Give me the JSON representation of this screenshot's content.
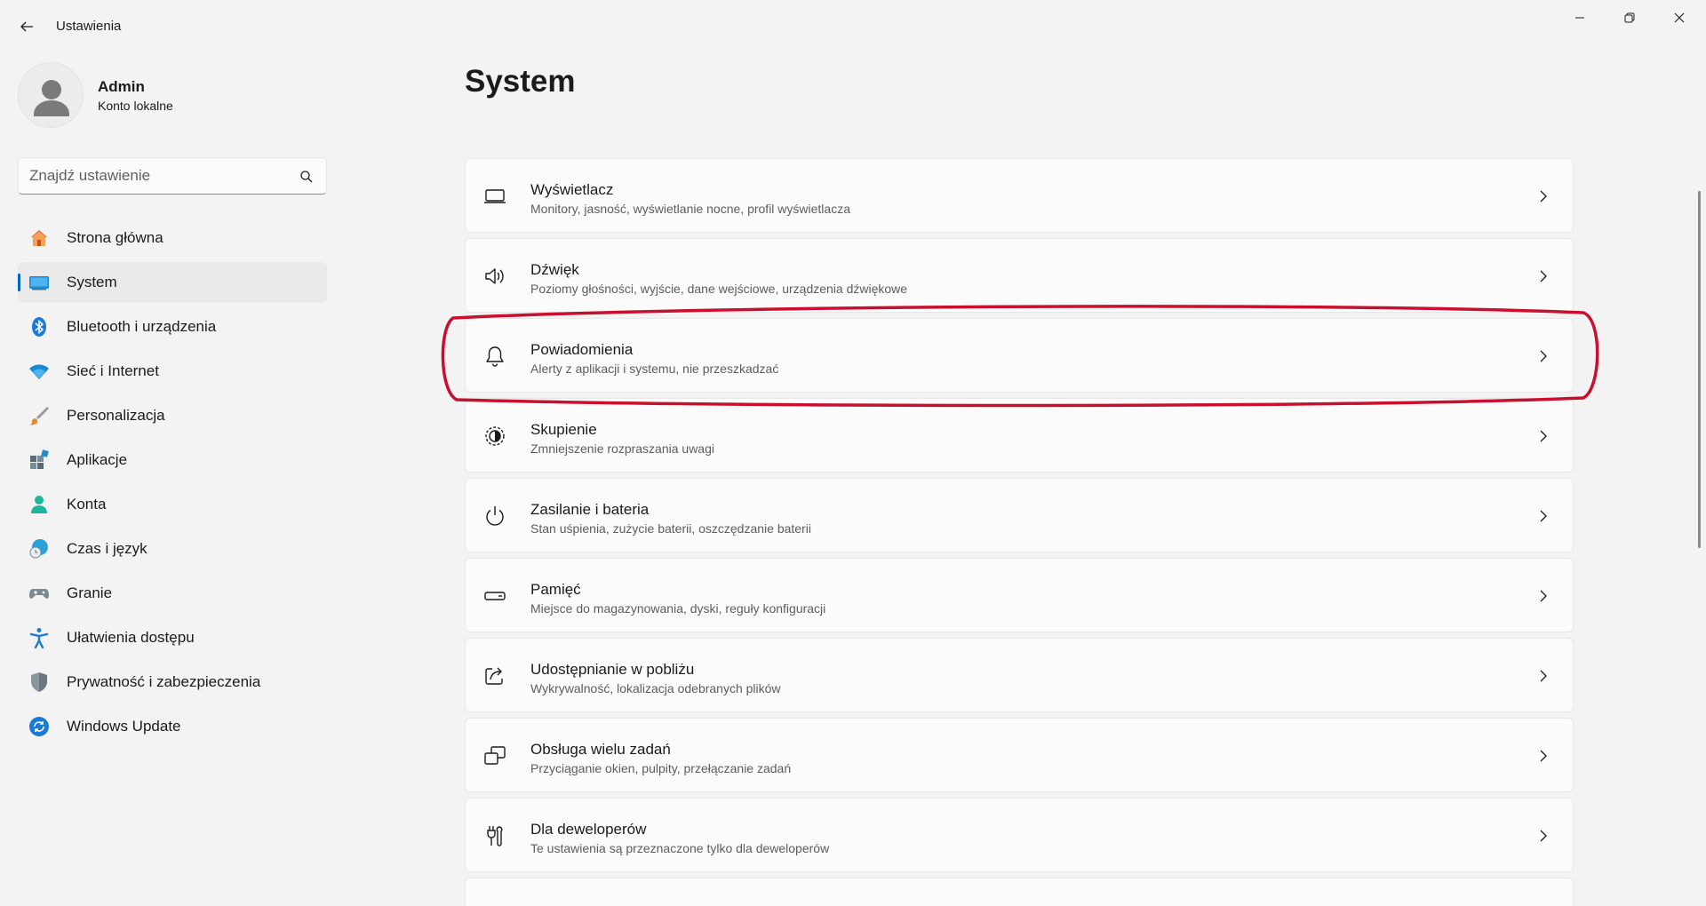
{
  "window": {
    "title": "Ustawienia",
    "controls": [
      "minimize-icon",
      "maximize-icon",
      "close-icon"
    ]
  },
  "profile": {
    "name": "Admin",
    "account": "Konto lokalne"
  },
  "search": {
    "placeholder": "Znajdź ustawienie",
    "value": ""
  },
  "sidebar": {
    "items": [
      {
        "label": "Strona główna",
        "icon": "home-icon"
      },
      {
        "label": "System",
        "icon": "system-icon",
        "active": true
      },
      {
        "label": "Bluetooth i urządzenia",
        "icon": "bluetooth-icon"
      },
      {
        "label": "Sieć i Internet",
        "icon": "wifi-icon"
      },
      {
        "label": "Personalizacja",
        "icon": "brush-icon"
      },
      {
        "label": "Aplikacje",
        "icon": "apps-icon"
      },
      {
        "label": "Konta",
        "icon": "account-icon"
      },
      {
        "label": "Czas i język",
        "icon": "globe-clock-icon"
      },
      {
        "label": "Granie",
        "icon": "gamepad-icon"
      },
      {
        "label": "Ułatwienia dostępu",
        "icon": "accessibility-icon"
      },
      {
        "label": "Prywatność i zabezpieczenia",
        "icon": "shield-icon"
      },
      {
        "label": "Windows Update",
        "icon": "update-icon"
      }
    ]
  },
  "main": {
    "title": "System",
    "items": [
      {
        "title": "Wyświetlacz",
        "desc": "Monitory, jasność, wyświetlanie nocne, profil wyświetlacza",
        "icon": "display-icon"
      },
      {
        "title": "Dźwięk",
        "desc": "Poziomy głośności, wyjście, dane wejściowe, urządzenia dźwiękowe",
        "icon": "speaker-icon"
      },
      {
        "title": "Powiadomienia",
        "desc": "Alerty z aplikacji i systemu, nie przeszkadzać",
        "icon": "bell-icon",
        "highlighted": true
      },
      {
        "title": "Skupienie",
        "desc": "Zmniejszenie rozpraszania uwagi",
        "icon": "focus-icon"
      },
      {
        "title": "Zasilanie i bateria",
        "desc": "Stan uśpienia, zużycie baterii, oszczędzanie baterii",
        "icon": "power-icon"
      },
      {
        "title": "Pamięć",
        "desc": "Miejsce do magazynowania, dyski, reguły konfiguracji",
        "icon": "storage-icon"
      },
      {
        "title": "Udostępnianie w pobliżu",
        "desc": "Wykrywalność, lokalizacja odebranych plików",
        "icon": "share-icon"
      },
      {
        "title": "Obsługa wielu zadań",
        "desc": "Przyciąganie okien, pulpity, przełączanie zadań",
        "icon": "multitask-icon"
      },
      {
        "title": "Dla deweloperów",
        "desc": "Te ustawienia są przeznaczone tylko dla deweloperów",
        "icon": "developer-tools-icon"
      }
    ]
  },
  "colors": {
    "accent": "#0067c0",
    "highlight_annotation": "#c8102e",
    "background": "#f3f3f3",
    "card": "#fbfbfb"
  }
}
